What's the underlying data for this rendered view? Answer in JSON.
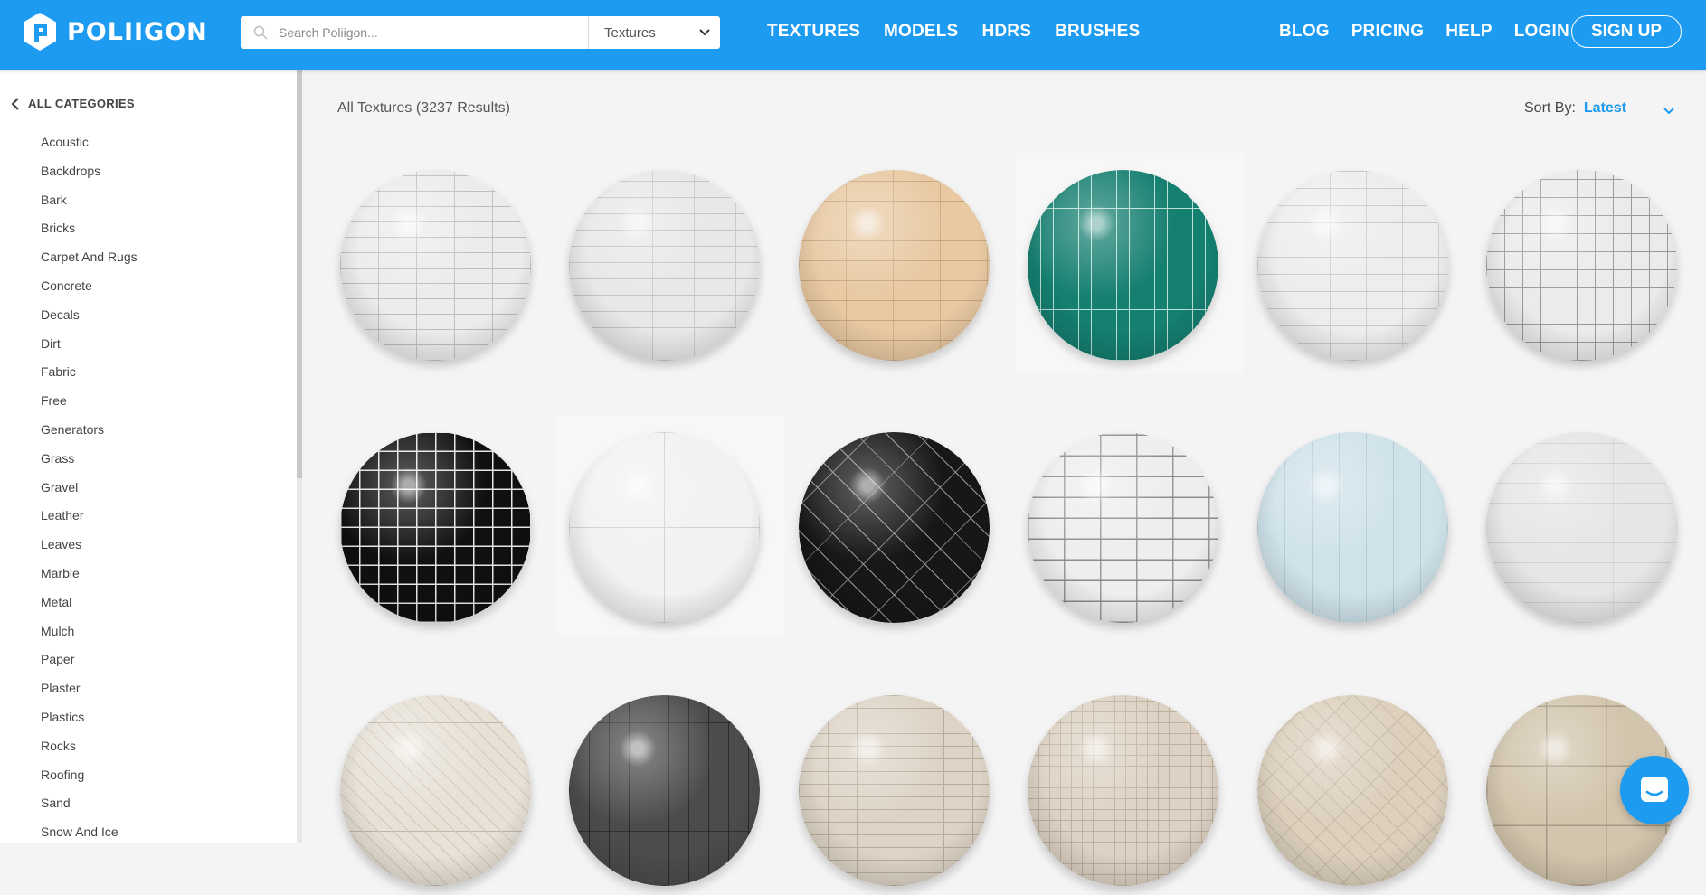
{
  "brand": {
    "name": "POLIIGON"
  },
  "search": {
    "placeholder": "Search Poliigon...",
    "category": "Textures"
  },
  "nav": {
    "primary": [
      "TEXTURES",
      "MODELS",
      "HDRS",
      "BRUSHES"
    ],
    "secondary": [
      "BLOG",
      "PRICING",
      "HELP",
      "LOGIN"
    ],
    "signup": "SIGN UP"
  },
  "sidebar": {
    "back_label": "ALL CATEGORIES",
    "categories": [
      "Acoustic",
      "Backdrops",
      "Bark",
      "Bricks",
      "Carpet And Rugs",
      "Concrete",
      "Decals",
      "Dirt",
      "Fabric",
      "Free",
      "Generators",
      "Grass",
      "Gravel",
      "Leather",
      "Leaves",
      "Marble",
      "Metal",
      "Mulch",
      "Paper",
      "Plaster",
      "Plastics",
      "Rocks",
      "Roofing",
      "Sand",
      "Snow And Ice"
    ]
  },
  "results": {
    "title": "All Textures (3237 Results)"
  },
  "sort": {
    "label": "Sort By:",
    "value": "Latest"
  },
  "icons": {
    "logo": "poliigon-logo-icon",
    "search": "search-icon",
    "select": "chevron-down-icon",
    "back": "chevron-left-icon",
    "sort": "chevron-down-icon",
    "chat": "chat-icon"
  },
  "colors": {
    "accent": "#1d9bf0"
  }
}
